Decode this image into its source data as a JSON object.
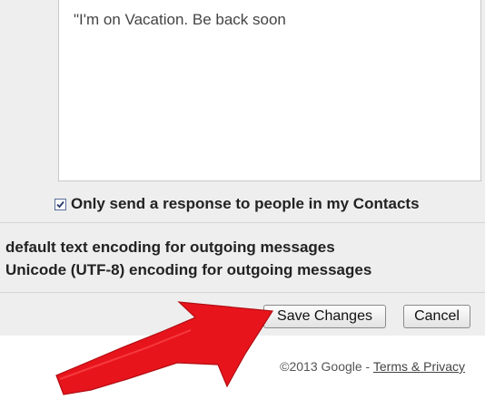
{
  "vacation_responder": {
    "message_body": "\"I'm on Vacation. Be back soon"
  },
  "contacts_option": {
    "label": "Only send a response to people in my Contacts",
    "checked": true
  },
  "encoding": {
    "option_default": "default text encoding for outgoing messages",
    "option_unicode": "Unicode (UTF-8) encoding for outgoing messages"
  },
  "actions": {
    "save_label": "Save Changes",
    "cancel_label": "Cancel"
  },
  "footer": {
    "copyright": "©2013 Google",
    "separator": " - ",
    "terms_label": "Terms & Privacy"
  },
  "annotation": {
    "arrow_color": "#e8141c",
    "arrow_target": "save-button"
  }
}
